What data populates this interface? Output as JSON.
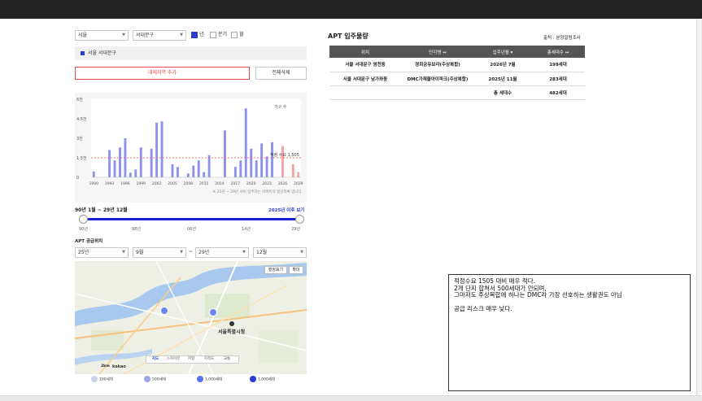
{
  "filters": {
    "city": "서울",
    "district": "서대문구",
    "period_options": [
      "년",
      "분기",
      "월"
    ],
    "period_selected": "년"
  },
  "region_tag": "서울 서대문구",
  "buttons": {
    "add_compare": "대체지역 추가",
    "delete_all": "전체삭제"
  },
  "chart_data": {
    "type": "bar",
    "ylabel": "가구 수",
    "y_ticks": [
      "6천",
      "4.5천",
      "3천",
      "1.5천",
      "0"
    ],
    "ylim": [
      0,
      6000
    ],
    "x_ticks": [
      "1990",
      "1993",
      "1996",
      "1999",
      "2002",
      "2005",
      "2008",
      "2011",
      "2014",
      "2017",
      "2020",
      "2023",
      "2026",
      "2029"
    ],
    "categories": [
      "1990",
      "1991",
      "1992",
      "1993",
      "1994",
      "1995",
      "1996",
      "1997",
      "1998",
      "1999",
      "2000",
      "2001",
      "2002",
      "2003",
      "2004",
      "2005",
      "2006",
      "2007",
      "2008",
      "2009",
      "2010",
      "2011",
      "2012",
      "2013",
      "2014",
      "2015",
      "2016",
      "2017",
      "2018",
      "2019",
      "2020",
      "2021",
      "2022",
      "2023",
      "2024",
      "2025",
      "2026",
      "2027",
      "2028",
      "2029"
    ],
    "values": [
      450,
      0,
      0,
      2100,
      1300,
      2300,
      3000,
      350,
      600,
      2300,
      0,
      2200,
      4200,
      4300,
      0,
      1000,
      800,
      0,
      300,
      900,
      1300,
      400,
      1700,
      0,
      0,
      3600,
      0,
      800,
      1300,
      5300,
      2200,
      1300,
      2600,
      1600,
      2700,
      0,
      2400,
      0,
      1000,
      400
    ],
    "projected_from": "2026",
    "reference_line": {
      "label": "적정 수요 1,505",
      "value": 1505
    },
    "footnote": "※ 25년 ~ 29년 사이 입주하는 아파트의 합산목록 입니다."
  },
  "range": {
    "label": "90년 1월 ~ 29년 12월",
    "after_link": "2025년 이후 보기",
    "ticks": [
      "90년",
      "98년",
      "06년",
      "14년",
      "29년"
    ]
  },
  "supply": {
    "title": "APT 공급위치",
    "from_year": "25년",
    "from_month": "9월",
    "tilde": "~",
    "to_year": "29년",
    "to_month": "12월"
  },
  "map": {
    "btn_admin": "행정표기",
    "btn_zoom": "확대",
    "tabs": [
      "지도",
      "스카이뷰",
      "지형",
      "지적도",
      "교통"
    ],
    "tab_selected": "지도",
    "scale": "2km",
    "brand": "kakao",
    "place_label": "서울특별시청",
    "legend": [
      "100세대",
      "500세대",
      "1,000세대",
      "1,000세대"
    ]
  },
  "apt_panel": {
    "title": "APT 입주물량",
    "source": "출처 : 분양알림조사",
    "headers": [
      "위치",
      "단지명 ↔",
      "입주년월 ▾",
      "총세대수 ↔"
    ],
    "rows": [
      [
        "서울 서대문구 영천동",
        "경희궁유보라(주상복합)",
        "2026년 7월",
        "199세대"
      ],
      [
        "서울 서대문구 남가좌동",
        "DMC가재울아이파크(주상복합)",
        "2025년 11월",
        "283세대"
      ]
    ],
    "total_label": "총 세대수",
    "total_value": "482세대"
  },
  "note": {
    "lines": [
      "적정수요 1505 대비 매우 적다.",
      "2개 단지 합쳐서 500세대가 안되며,",
      "그마저도 주상복합에 하나는 DMC라 가장 선호하는 생활권도 아님",
      "",
      "공급 리스크 매우 낮다."
    ]
  },
  "colors": {
    "bar": "#8b93ee",
    "bar_projected": "#f3a3a3",
    "accent": "#2b3bd6",
    "danger": "#e44b4b",
    "header": "#555555"
  }
}
